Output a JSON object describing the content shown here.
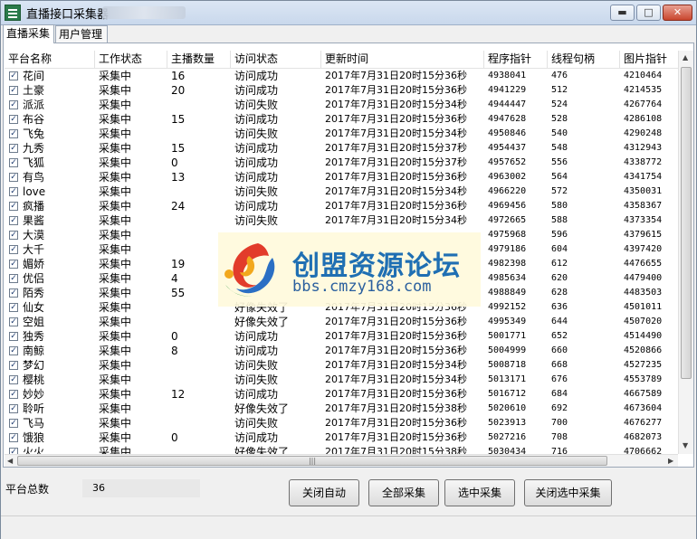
{
  "window": {
    "title": "直播接口采集器",
    "min_glyph": "▬",
    "max_glyph": "□",
    "close_glyph": "✕"
  },
  "tabs": [
    {
      "label": "直播采集",
      "active": true
    },
    {
      "label": "用户管理",
      "active": false
    }
  ],
  "table": {
    "columns": [
      "平台名称",
      "工作状态",
      "主播数量",
      "访问状态",
      "更新时间",
      "程序指针",
      "线程句柄",
      "图片指针"
    ],
    "rows": [
      {
        "checked": true,
        "name": "花间",
        "status": "采集中",
        "count": "16",
        "access": "访问成功",
        "time": "2017年7月31日20时15分36秒",
        "ptr": "4938041",
        "handle": "476",
        "img": "4210464"
      },
      {
        "checked": true,
        "name": "土豪",
        "status": "采集中",
        "count": "20",
        "access": "访问成功",
        "time": "2017年7月31日20时15分36秒",
        "ptr": "4941229",
        "handle": "512",
        "img": "4214535"
      },
      {
        "checked": true,
        "name": "派派",
        "status": "采集中",
        "count": "",
        "access": "访问失败",
        "time": "2017年7月31日20时15分34秒",
        "ptr": "4944447",
        "handle": "524",
        "img": "4267764"
      },
      {
        "checked": true,
        "name": "布谷",
        "status": "采集中",
        "count": "15",
        "access": "访问成功",
        "time": "2017年7月31日20时15分36秒",
        "ptr": "4947628",
        "handle": "528",
        "img": "4286108"
      },
      {
        "checked": true,
        "name": "飞兔",
        "status": "采集中",
        "count": "",
        "access": "访问失败",
        "time": "2017年7月31日20时15分34秒",
        "ptr": "4950846",
        "handle": "540",
        "img": "4290248"
      },
      {
        "checked": true,
        "name": "九秀",
        "status": "采集中",
        "count": "15",
        "access": "访问成功",
        "time": "2017年7月31日20时15分37秒",
        "ptr": "4954437",
        "handle": "548",
        "img": "4312943"
      },
      {
        "checked": true,
        "name": "飞狐",
        "status": "采集中",
        "count": "0",
        "access": "访问成功",
        "time": "2017年7月31日20时15分37秒",
        "ptr": "4957652",
        "handle": "556",
        "img": "4338772"
      },
      {
        "checked": true,
        "name": "有鸟",
        "status": "采集中",
        "count": "13",
        "access": "访问成功",
        "time": "2017年7月31日20时15分36秒",
        "ptr": "4963002",
        "handle": "564",
        "img": "4341754"
      },
      {
        "checked": true,
        "name": "love",
        "status": "采集中",
        "count": "",
        "access": "访问失败",
        "time": "2017年7月31日20时15分34秒",
        "ptr": "4966220",
        "handle": "572",
        "img": "4350031"
      },
      {
        "checked": true,
        "name": "疯播",
        "status": "采集中",
        "count": "24",
        "access": "访问成功",
        "time": "2017年7月31日20时15分36秒",
        "ptr": "4969456",
        "handle": "580",
        "img": "4358367"
      },
      {
        "checked": true,
        "name": "果酱",
        "status": "采集中",
        "count": "",
        "access": "访问失败",
        "time": "2017年7月31日20时15分34秒",
        "ptr": "4972665",
        "handle": "588",
        "img": "4373354"
      },
      {
        "checked": true,
        "name": "大漠",
        "status": "采集中",
        "count": "",
        "access": "",
        "time": "",
        "ptr": "4975968",
        "handle": "596",
        "img": "4379615"
      },
      {
        "checked": true,
        "name": "大千",
        "status": "采集中",
        "count": "",
        "access": "",
        "time": "",
        "ptr": "4979186",
        "handle": "604",
        "img": "4397420"
      },
      {
        "checked": true,
        "name": "媚娇",
        "status": "采集中",
        "count": "19",
        "access": "",
        "time": "",
        "ptr": "4982398",
        "handle": "612",
        "img": "4476655"
      },
      {
        "checked": true,
        "name": "优侣",
        "status": "采集中",
        "count": "4",
        "access": "",
        "time": "",
        "ptr": "4985634",
        "handle": "620",
        "img": "4479400"
      },
      {
        "checked": true,
        "name": "陌秀",
        "status": "采集中",
        "count": "55",
        "access": "",
        "time": "",
        "ptr": "4988849",
        "handle": "628",
        "img": "4483503"
      },
      {
        "checked": true,
        "name": "仙女",
        "status": "采集中",
        "count": "",
        "access": "好像失效了",
        "time": "2017年7月31日20时15分36秒",
        "ptr": "4992152",
        "handle": "636",
        "img": "4501011"
      },
      {
        "checked": true,
        "name": "空姐",
        "status": "采集中",
        "count": "",
        "access": "好像失效了",
        "time": "2017年7月31日20时15分36秒",
        "ptr": "4995349",
        "handle": "644",
        "img": "4507020"
      },
      {
        "checked": true,
        "name": "独秀",
        "status": "采集中",
        "count": "0",
        "access": "访问成功",
        "time": "2017年7月31日20时15分36秒",
        "ptr": "5001771",
        "handle": "652",
        "img": "4514490"
      },
      {
        "checked": true,
        "name": "南鲸",
        "status": "采集中",
        "count": "8",
        "access": "访问成功",
        "time": "2017年7月31日20时15分36秒",
        "ptr": "5004999",
        "handle": "660",
        "img": "4520866"
      },
      {
        "checked": true,
        "name": "梦幻",
        "status": "采集中",
        "count": "",
        "access": "访问失败",
        "time": "2017年7月31日20时15分34秒",
        "ptr": "5008718",
        "handle": "668",
        "img": "4527235"
      },
      {
        "checked": true,
        "name": "樱桃",
        "status": "采集中",
        "count": "",
        "access": "访问失败",
        "time": "2017年7月31日20时15分34秒",
        "ptr": "5013171",
        "handle": "676",
        "img": "4553789"
      },
      {
        "checked": true,
        "name": "妙妙",
        "status": "采集中",
        "count": "12",
        "access": "访问成功",
        "time": "2017年7月31日20时15分36秒",
        "ptr": "5016712",
        "handle": "684",
        "img": "4667589"
      },
      {
        "checked": true,
        "name": "聆听",
        "status": "采集中",
        "count": "",
        "access": "好像失效了",
        "time": "2017年7月31日20时15分38秒",
        "ptr": "5020610",
        "handle": "692",
        "img": "4673604"
      },
      {
        "checked": true,
        "name": "飞马",
        "status": "采集中",
        "count": "",
        "access": "访问失败",
        "time": "2017年7月31日20时15分36秒",
        "ptr": "5023913",
        "handle": "700",
        "img": "4676277"
      },
      {
        "checked": true,
        "name": "饿狼",
        "status": "采集中",
        "count": "0",
        "access": "访问成功",
        "time": "2017年7月31日20时15分36秒",
        "ptr": "5027216",
        "handle": "708",
        "img": "4682073"
      },
      {
        "checked": true,
        "name": "火火",
        "status": "采集中",
        "count": "",
        "access": "好像失效了",
        "time": "2017年7月31日20时15分38秒",
        "ptr": "5030434",
        "handle": "716",
        "img": "4706662"
      }
    ]
  },
  "footer": {
    "total_label": "平台总数",
    "total_value": "36",
    "buttons": [
      "关闭自动",
      "全部采集",
      "选中采集",
      "关闭选中采集"
    ]
  },
  "watermark": {
    "title": "创盟资源论坛",
    "url": "bbs.cmzy168.com"
  },
  "icons": [
    "app-icon",
    "minimize-icon",
    "maximize-icon",
    "close-icon",
    "checkbox-icon",
    "scroll-up-icon",
    "scroll-down-icon",
    "scroll-left-icon",
    "scroll-right-icon",
    "watermark-logo-icon"
  ],
  "colors": {
    "titlebar": "#c9d8ec",
    "close_button": "#c9462e",
    "watermark_blue": "#1f6fb3"
  }
}
